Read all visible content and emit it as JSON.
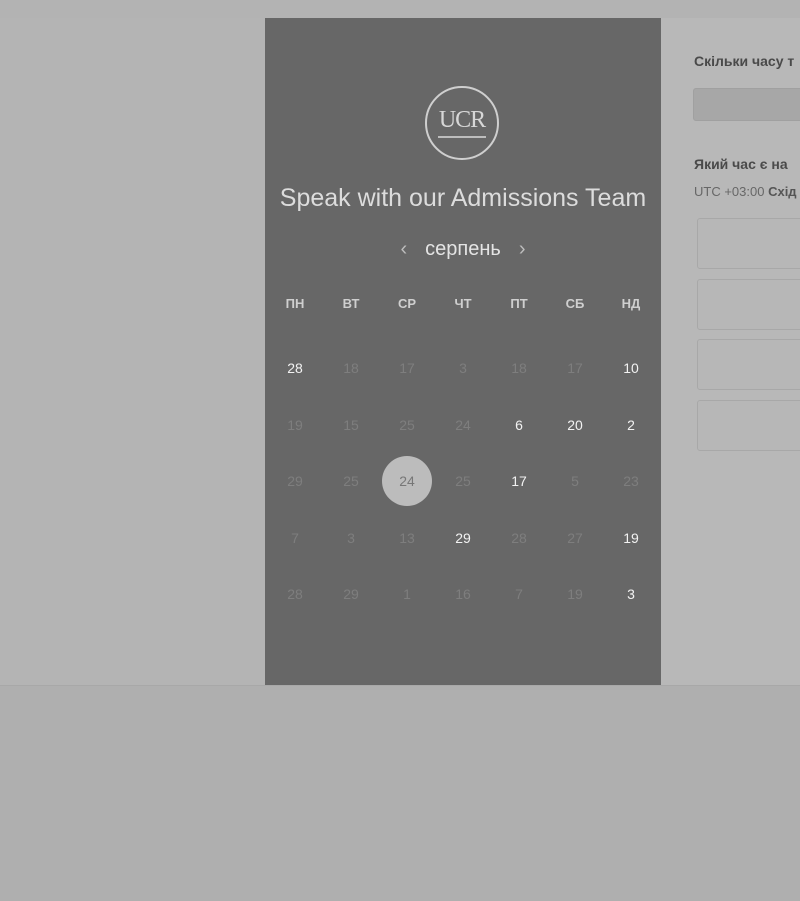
{
  "calendar": {
    "title": "Speak with our Admissions Team",
    "logo_text": "UCR",
    "month": "серпень",
    "prev_label": "‹",
    "next_label": "›",
    "weekdays": [
      "ПН",
      "ВТ",
      "СР",
      "ЧТ",
      "ПТ",
      "СБ",
      "НД"
    ],
    "weeks": [
      [
        {
          "d": "28",
          "a": true
        },
        {
          "d": "18",
          "a": false
        },
        {
          "d": "17",
          "a": false
        },
        {
          "d": "3",
          "a": false
        },
        {
          "d": "18",
          "a": false
        },
        {
          "d": "17",
          "a": false
        },
        {
          "d": "10",
          "a": true
        }
      ],
      [
        {
          "d": "19",
          "a": false
        },
        {
          "d": "15",
          "a": false
        },
        {
          "d": "25",
          "a": false
        },
        {
          "d": "24",
          "a": false
        },
        {
          "d": "6",
          "a": true
        },
        {
          "d": "20",
          "a": true
        },
        {
          "d": "2",
          "a": true
        }
      ],
      [
        {
          "d": "29",
          "a": false
        },
        {
          "d": "25",
          "a": false
        },
        {
          "d": "24",
          "a": false,
          "s": true
        },
        {
          "d": "25",
          "a": false
        },
        {
          "d": "17",
          "a": true
        },
        {
          "d": "5",
          "a": false
        },
        {
          "d": "23",
          "a": false
        }
      ],
      [
        {
          "d": "7",
          "a": false
        },
        {
          "d": "3",
          "a": false
        },
        {
          "d": "13",
          "a": false
        },
        {
          "d": "29",
          "a": true
        },
        {
          "d": "28",
          "a": false
        },
        {
          "d": "27",
          "a": false
        },
        {
          "d": "19",
          "a": true
        }
      ],
      [
        {
          "d": "28",
          "a": false
        },
        {
          "d": "29",
          "a": false
        },
        {
          "d": "1",
          "a": false
        },
        {
          "d": "16",
          "a": false
        },
        {
          "d": "7",
          "a": false
        },
        {
          "d": "19",
          "a": false
        },
        {
          "d": "3",
          "a": true
        }
      ]
    ]
  },
  "details": {
    "duration_question": "Скільки часу т",
    "time_question": "Який час є на",
    "timezone_prefix": "UTC +03:00",
    "timezone_name": "Схід"
  }
}
